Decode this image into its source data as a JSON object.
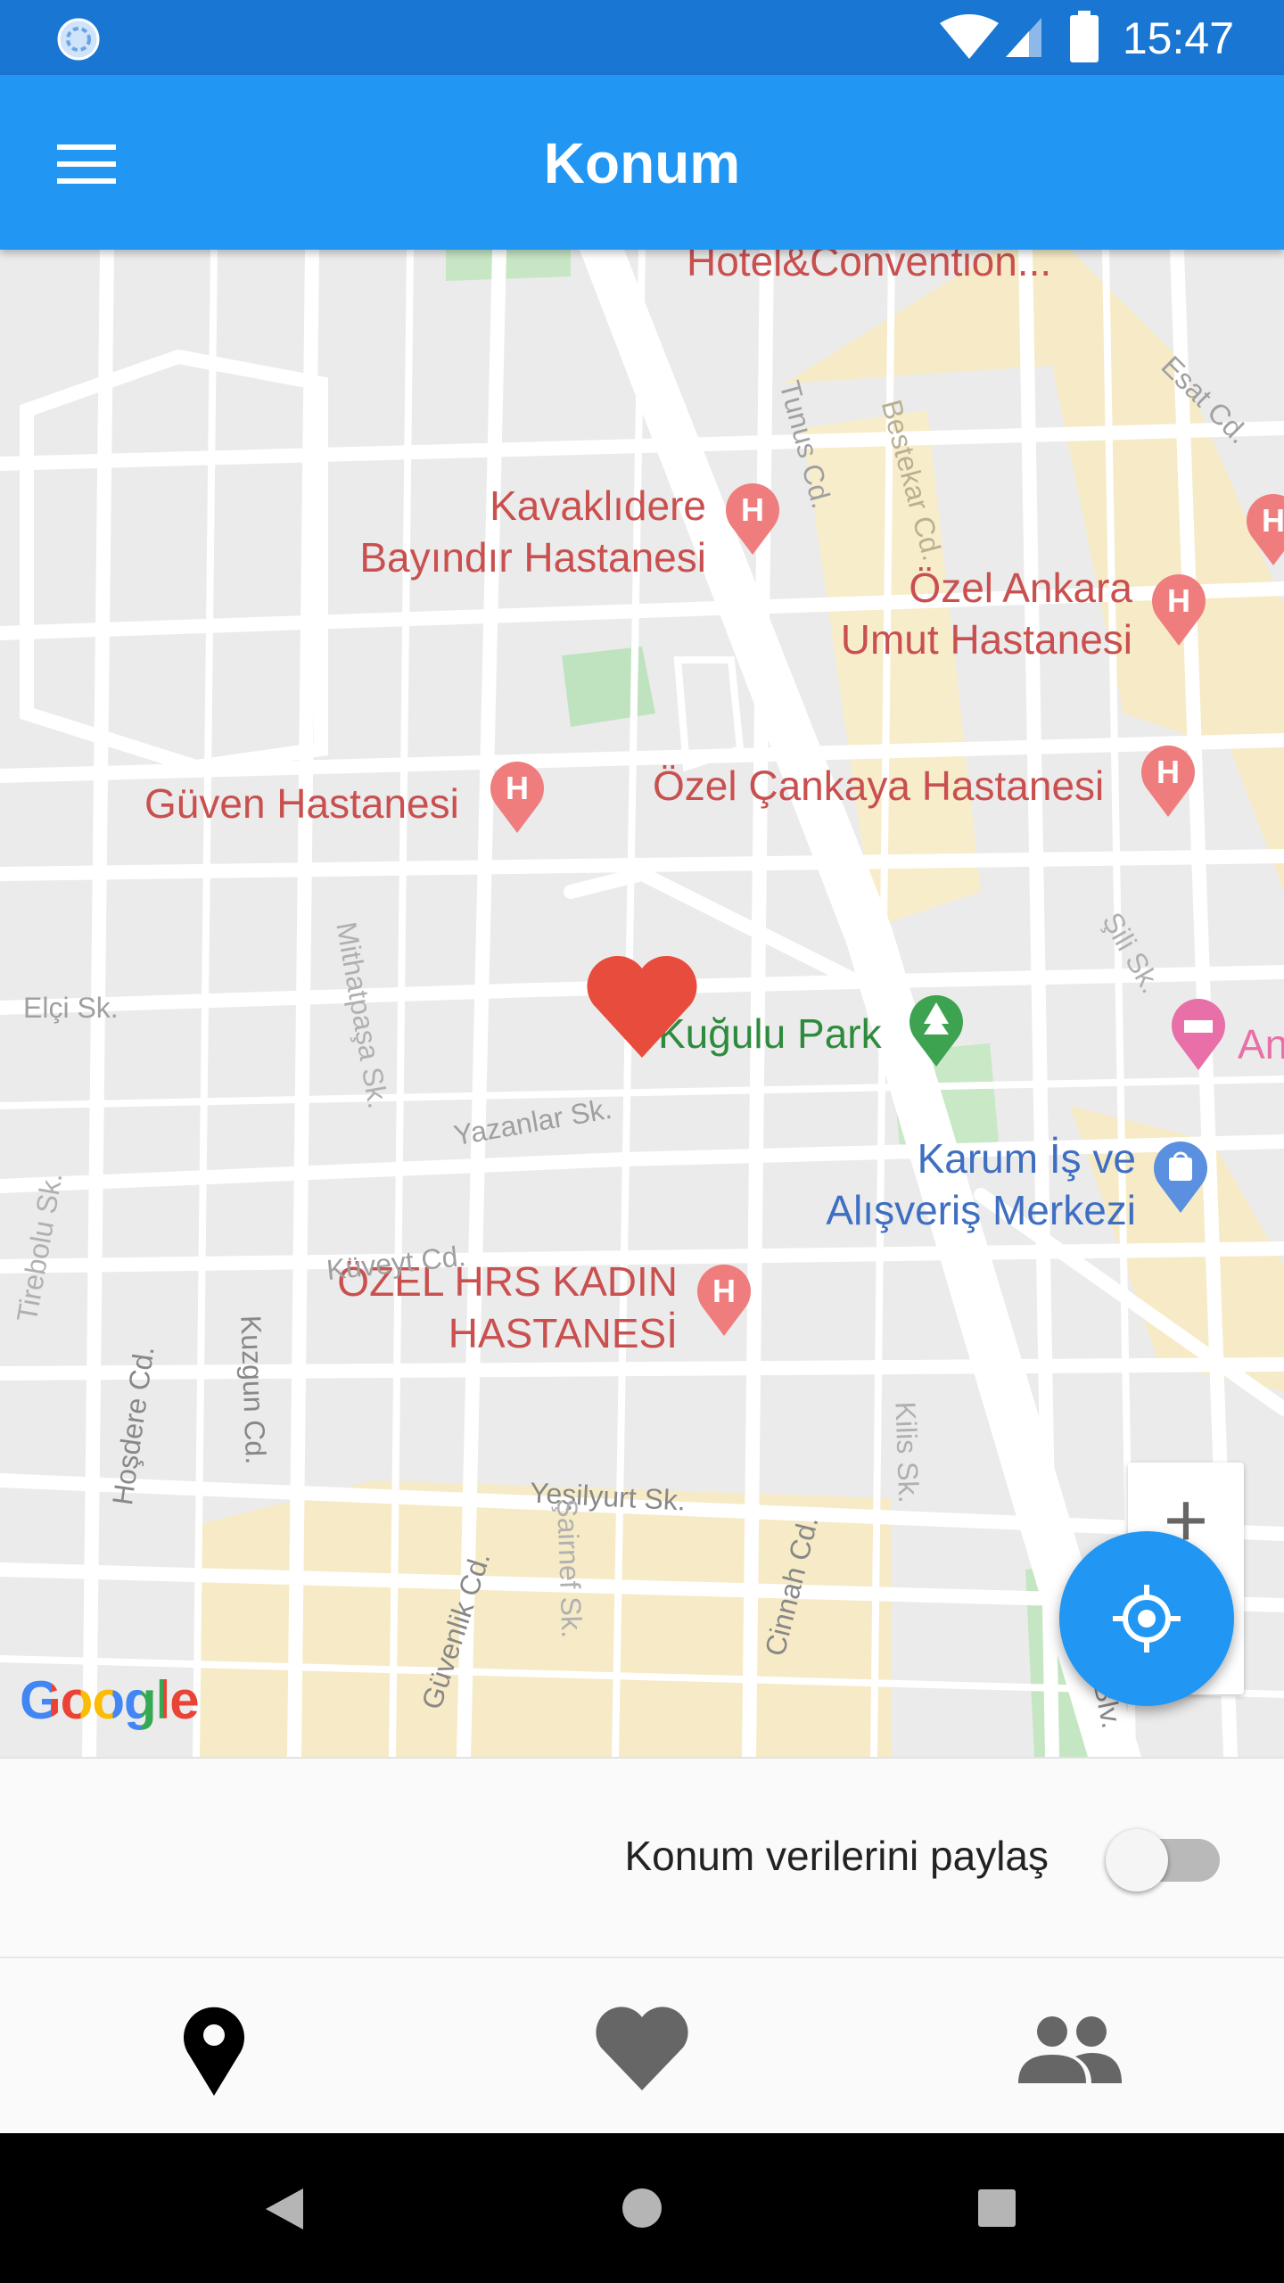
{
  "status_bar": {
    "time": "15:47"
  },
  "app_bar": {
    "title": "Konum"
  },
  "map": {
    "pois": {
      "kavaklidere": "Kavaklıdere\nBayındır Hastanesi",
      "ozel_ankara": "Özel Ankara\nUmut Hastanesi",
      "guven": "Güven Hastanesi",
      "ozel_cankaya": "Özel Çankaya Hastanesi",
      "kugulu_park": "Kuğulu Park",
      "karum": "Karum İş ve\nAlışveriş Merkezi",
      "ozel_hrs": "ÖZEL HRS KADIN\nHASTANESİ",
      "top_cut": "Hotel&Convention...",
      "right_cut": "An"
    },
    "streets": {
      "elci": "Elçi Sk.",
      "yazanlar": "Yazanlar Sk.",
      "kuveyt": "Küveyt Cd.",
      "yesilyurt": "Yeşilyurt Sk.",
      "cinnah": "Cinnah Cd.",
      "hosdere": "Hoşdere Cd.",
      "kuzgun": "Kuzgun Cd.",
      "guvenlik": "Güvenlik Cd.",
      "ataturk": "Atatürk Blv.",
      "tunus": "Tunus Cd.",
      "bestekar": "Bestekar Cd.",
      "esat": "Esat Cd.",
      "mithat": "Mithatpaşa Sk.",
      "tirebolu": "Tirebolu Sk.",
      "kilis": "Kilis Sk.",
      "sili": "Şili Sk.",
      "sairnef": "Şairnef Sk."
    },
    "attribution": "Google",
    "zoom_in_label": "+",
    "marker_icon": "heart-icon"
  },
  "share_bar": {
    "label": "Konum verilerini paylaş",
    "toggle_on": false
  },
  "bottom_nav": {
    "items": [
      {
        "icon": "location-pin-icon",
        "active": true
      },
      {
        "icon": "heart-icon",
        "active": false
      },
      {
        "icon": "people-icon",
        "active": false
      }
    ]
  },
  "colors": {
    "primary": "#2196f3",
    "primary_dark": "#1976d2",
    "marker": "#e84c3d"
  }
}
